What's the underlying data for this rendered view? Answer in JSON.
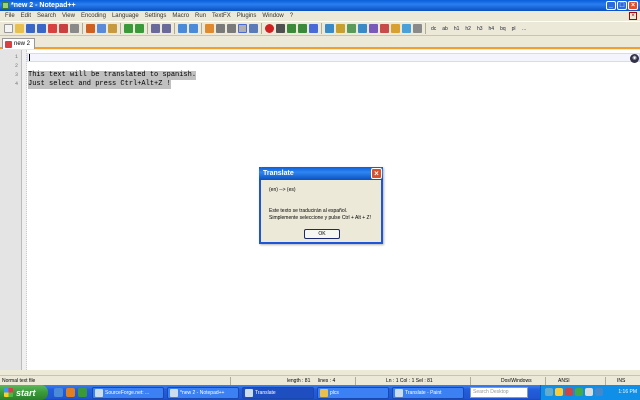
{
  "window": {
    "title": "*new 2 - Notepad++"
  },
  "menu": [
    "File",
    "Edit",
    "Search",
    "View",
    "Encoding",
    "Language",
    "Settings",
    "Macro",
    "Run",
    "TextFX",
    "Plugins",
    "Window",
    "?"
  ],
  "toolbar_text": [
    "dc",
    "ab",
    "h1",
    "h2",
    "h3",
    "h4",
    "bq",
    "pl",
    "…"
  ],
  "tab": {
    "label": "new 2"
  },
  "editor": {
    "line_numbers": [
      "1",
      "2",
      "3",
      "4"
    ],
    "lines": [
      "",
      "",
      "This text will be translated to spanish.",
      "Just select and press Ctrl+Alt+Z !"
    ]
  },
  "dialog": {
    "title": "Translate",
    "lang": "(en) --> (es)",
    "line1": "Este texto se traducirán al español.",
    "line2": "Simplemente seleccione y pulse Ctrl + Alt + Z!",
    "ok": "OK"
  },
  "status": {
    "type": "Normal text file",
    "length": "length : 81",
    "lines": "lines : 4",
    "position": "Ln : 1    Col : 1    Sel : 81",
    "eol": "Dos\\Windows",
    "encoding": "ANSI",
    "mode": "INS"
  },
  "taskbar": {
    "start": "start",
    "tasks": [
      "SourceForge.net: ...",
      "*new 2 - Notepad++",
      "Translate",
      "plcs",
      "Translate - Paint"
    ],
    "search_placeholder": "Search Desktop",
    "clock": "1:16 PM"
  },
  "colors": {
    "accent": "#1d56d8",
    "tab_underline": "#f0a030",
    "selection": "#c0c0c0"
  }
}
